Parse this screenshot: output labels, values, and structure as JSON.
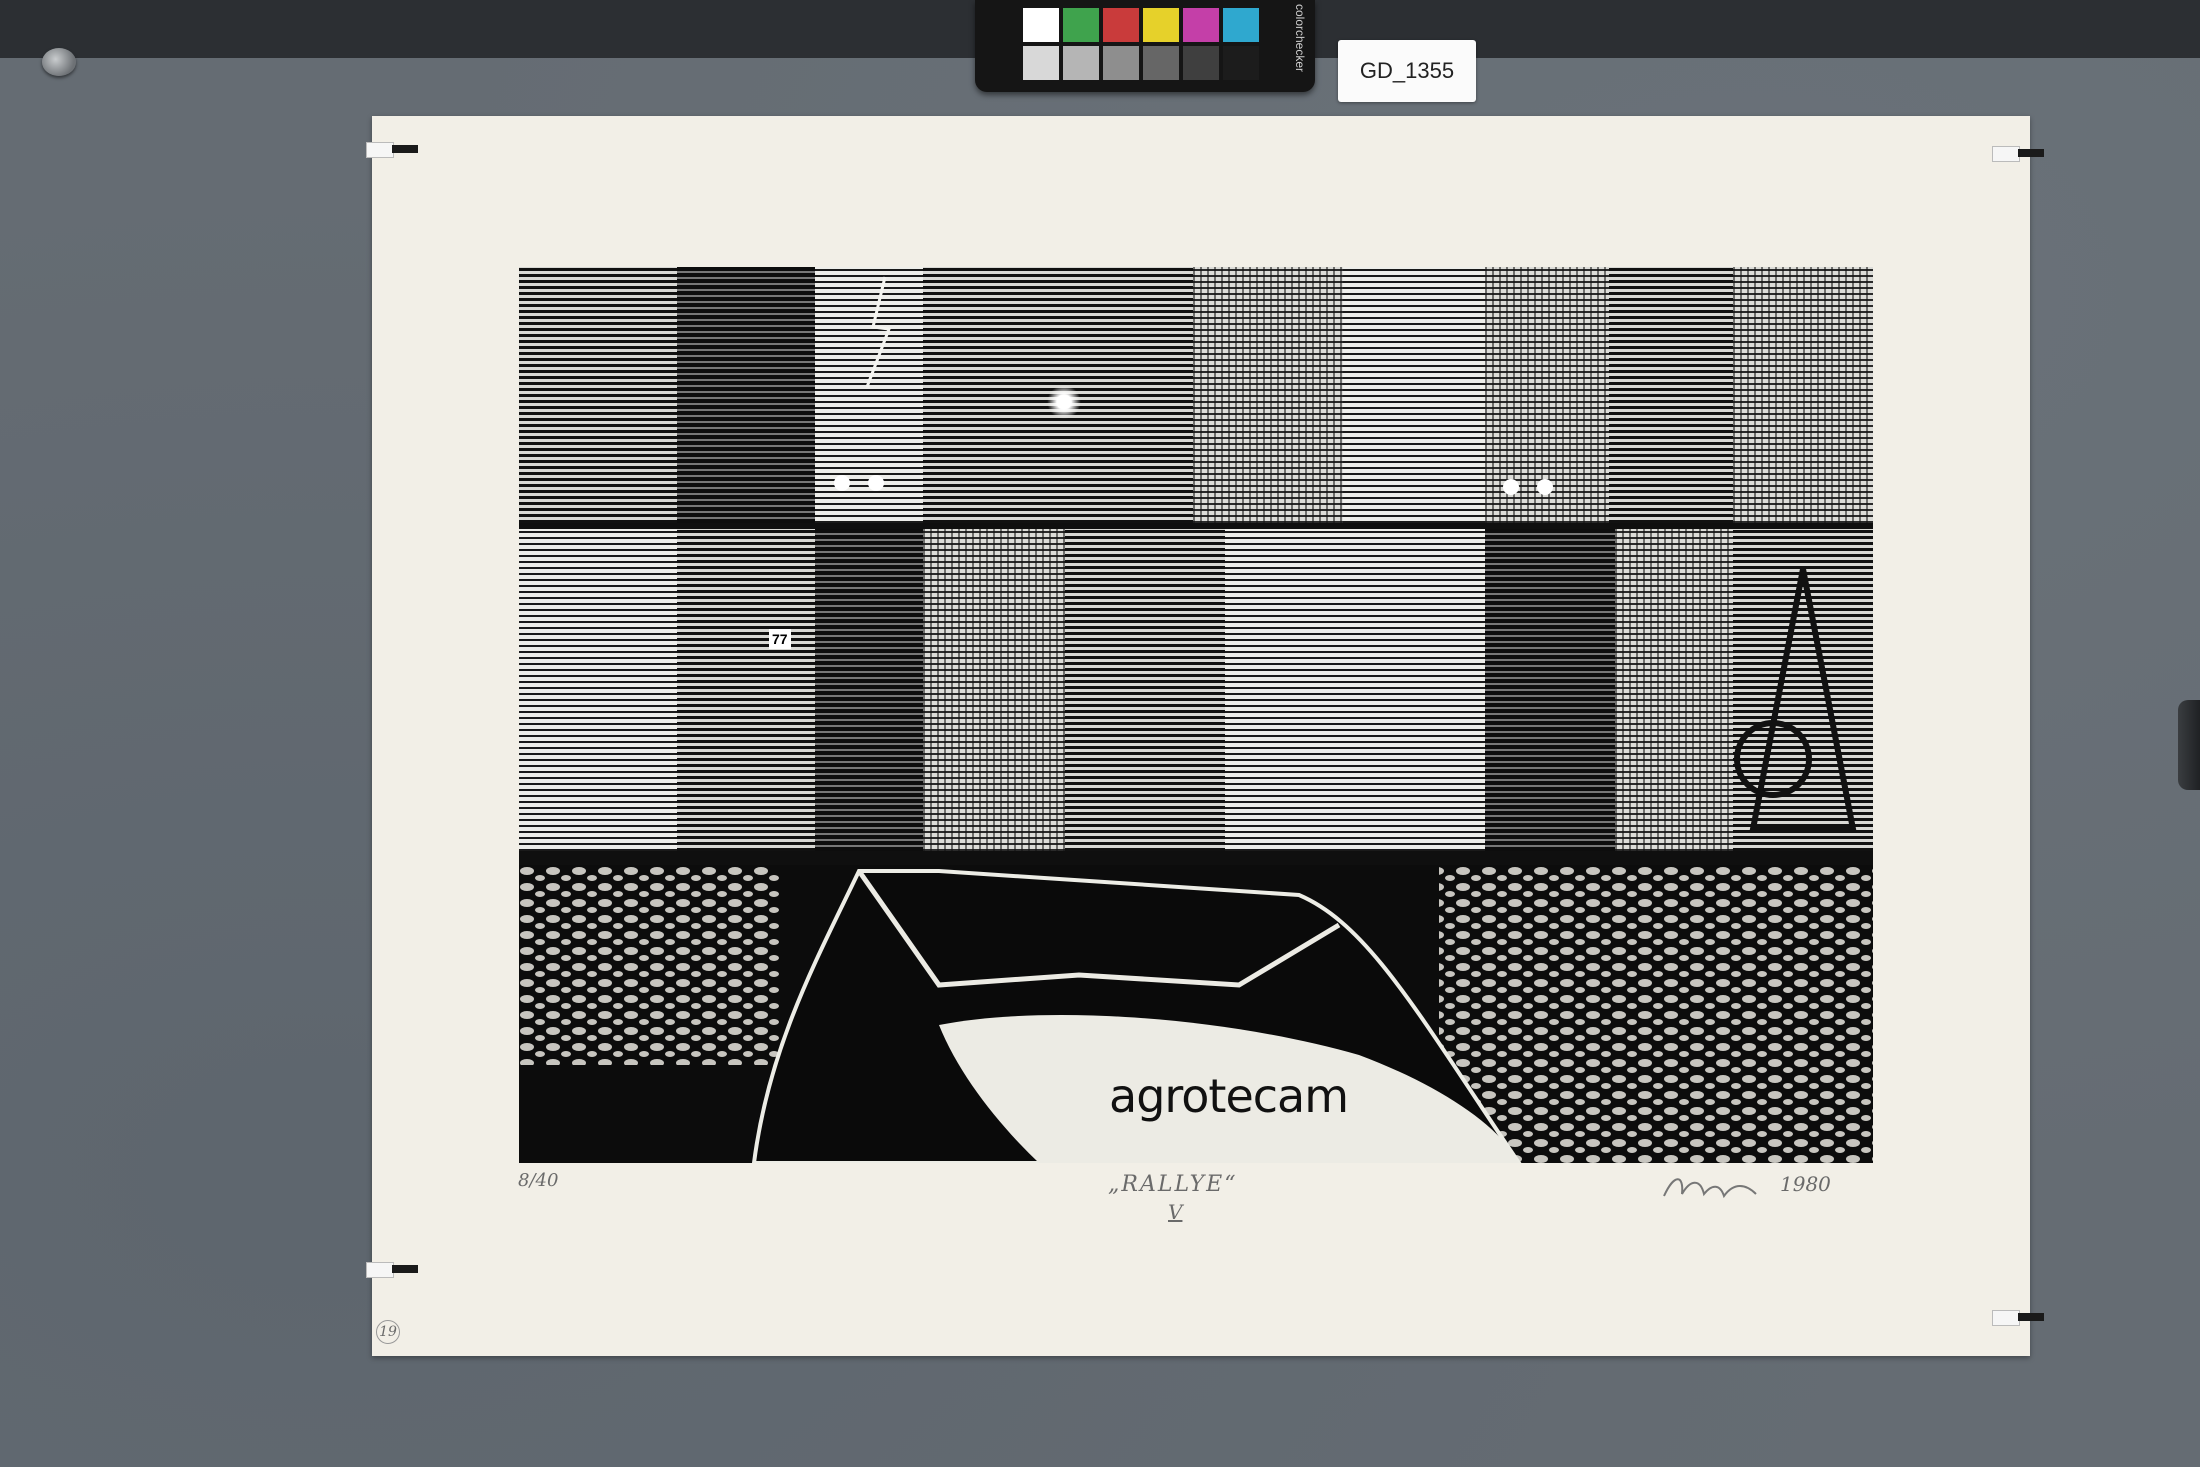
{
  "catalog_label": "GD_1355",
  "color_checker": {
    "brand_text": "colorchecker",
    "swatches": [
      "#ffffff",
      "#3fa34d",
      "#c93b3b",
      "#e6d12a",
      "#c43fa8",
      "#2fa8cf",
      "#d8d8d8",
      "#b5b5b5",
      "#8e8e8e",
      "#666666",
      "#3f3f3f",
      "#1c1c1c"
    ]
  },
  "print": {
    "title": "„RALLYE“",
    "title_number": "V",
    "edition": "8/40",
    "signature_year": "1980",
    "car_lettering": "agrotecam",
    "car_number": "77",
    "palette": {
      "ink": "#0f0f0f",
      "paper": "#f2efe7"
    }
  },
  "paper_margin_note": "19"
}
